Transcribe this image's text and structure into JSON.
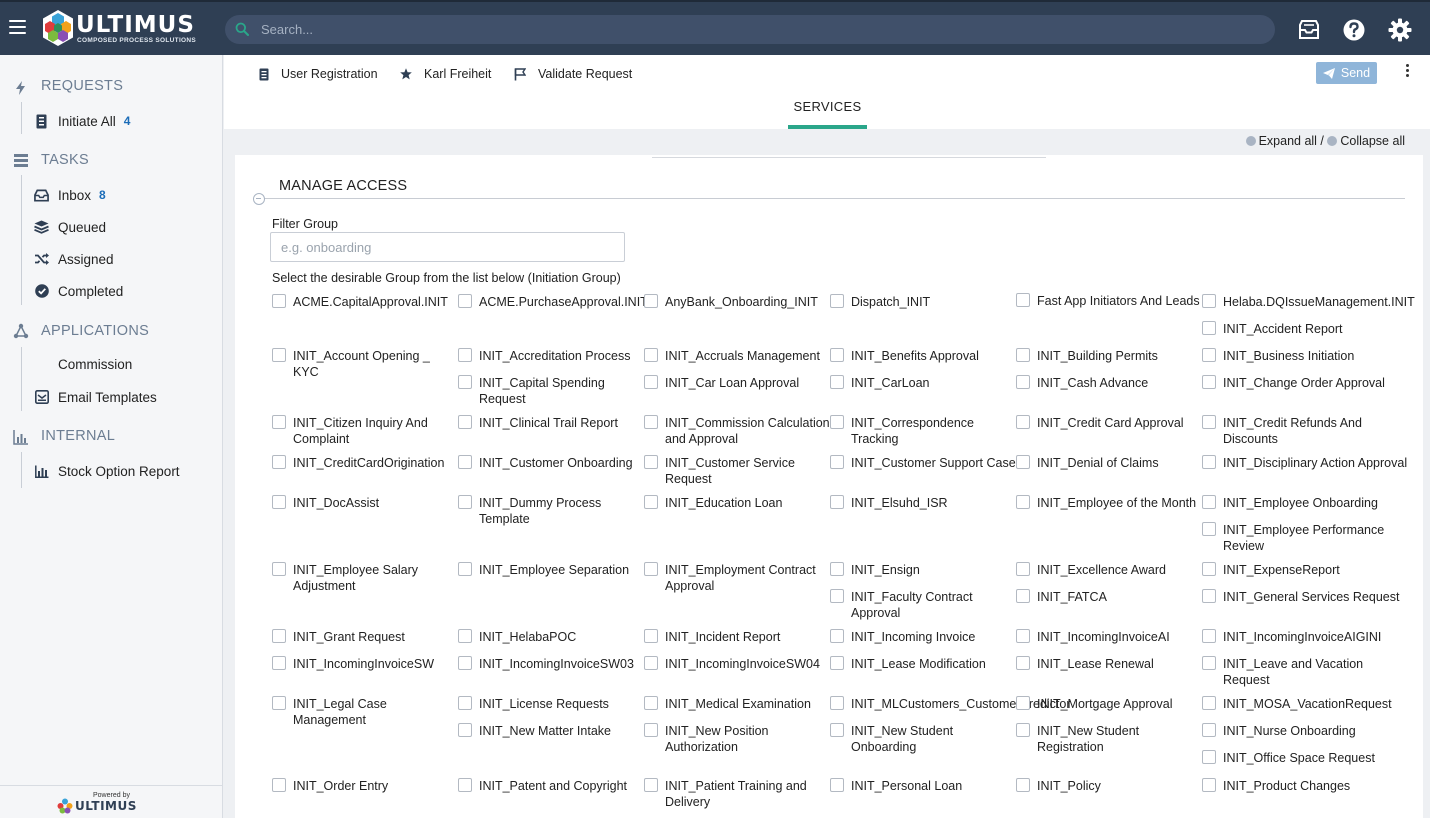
{
  "topbar": {
    "logo_text": "ULTIMUS",
    "logo_sub": "COMPOSED PROCESS SOLUTIONS",
    "search_placeholder": "Search..."
  },
  "sidebar": {
    "requests_title": "REQUESTS",
    "initiate_all": "Initiate All",
    "initiate_count": "4",
    "tasks_title": "TASKS",
    "inbox": "Inbox",
    "inbox_count": "8",
    "queued": "Queued",
    "assigned": "Assigned",
    "completed": "Completed",
    "applications_title": "APPLICATIONS",
    "commission": "Commission",
    "email_templates": "Email Templates",
    "internal_title": "INTERNAL",
    "stock_option_report": "Stock Option Report",
    "powered_by": "Powered by",
    "powered_logo": "ULTIMUS"
  },
  "actionbar": {
    "user_registration": "User Registration",
    "user_name": "Karl Freiheit",
    "validate_request": "Validate Request",
    "send": "Send",
    "tab_services": "SERVICES"
  },
  "expand": {
    "expand_all": "Expand all",
    "sep": " / ",
    "collapse_all": "Collapse all"
  },
  "section": {
    "title": "MANAGE ACCESS",
    "filter_label": "Filter Group",
    "filter_placeholder": "e.g. onboarding",
    "select_text": "Select the desirable Group from the list below (Initiation Group)"
  },
  "groups": [
    "ACME.CapitalApproval.INIT",
    "ACME.PurchaseApproval.INIT",
    "AnyBank_Onboarding_INIT",
    "Dispatch_INIT",
    "Fast App Initiators And Leads",
    "Helaba.DQIssueManagement.INIT",
    "INIT_Accident Report",
    "INIT_Account Opening _ KYC",
    "INIT_Accreditation Process",
    "INIT_Accruals Management",
    "INIT_Benefits Approval",
    "INIT_Building Permits",
    "INIT_Business Initiation",
    "INIT_Capital Spending Request",
    "INIT_Car Loan Approval",
    "INIT_CarLoan",
    "INIT_Cash Advance",
    "INIT_Change Order Approval",
    "INIT_Citizen Inquiry And Complaint",
    "INIT_Clinical Trail Report",
    "INIT_Commission Calculation and Approval",
    "INIT_Correspondence Tracking",
    "INIT_Credit Card Approval",
    "INIT_Credit Refunds And Discounts",
    "INIT_CreditCardOrigination",
    "INIT_Customer Onboarding",
    "INIT_Customer Service Request",
    "INIT_Customer Support Case",
    "INIT_Denial of Claims",
    "INIT_Disciplinary Action Approval",
    "INIT_DocAssist",
    "INIT_Dummy Process Template",
    "INIT_Education Loan",
    "INIT_Elsuhd_ISR",
    "INIT_Employee of the Month",
    "INIT_Employee Onboarding",
    "INIT_Employee Performance Review",
    "INIT_Employee Salary Adjustment",
    "INIT_Employee Separation",
    "INIT_Employment Contract Approval",
    "INIT_Ensign",
    "INIT_Excellence Award",
    "INIT_ExpenseReport",
    "INIT_Faculty Contract Approval",
    "INIT_FATCA",
    "INIT_General Services Request",
    "INIT_Grant Request",
    "INIT_HelabaPOC",
    "INIT_Incident Report",
    "INIT_Incoming Invoice",
    "INIT_IncomingInvoiceAI",
    "INIT_IncomingInvoiceAIGINI",
    "INIT_IncomingInvoiceSW",
    "INIT_IncomingInvoiceSW03",
    "INIT_IncomingInvoiceSW04",
    "INIT_Lease Modification",
    "INIT_Lease Renewal",
    "INIT_Leave and Vacation Request",
    "INIT_Legal Case Management",
    "INIT_License Requests",
    "INIT_Medical Examination",
    "INIT_MLCustomers_CustomerPredictor",
    "INIT_Mortgage Approval",
    "INIT_MOSA_VacationRequest",
    "INIT_New Matter Intake",
    "INIT_New Position Authorization",
    "INIT_New Student Onboarding",
    "INIT_New Student Registration",
    "INIT_Nurse Onboarding",
    "INIT_Office Space Request",
    "INIT_Order Entry",
    "INIT_Patent and Copyright",
    "INIT_Patient Training and Delivery",
    "INIT_Personal Loan",
    "INIT_Policy",
    "INIT_Product Changes"
  ]
}
